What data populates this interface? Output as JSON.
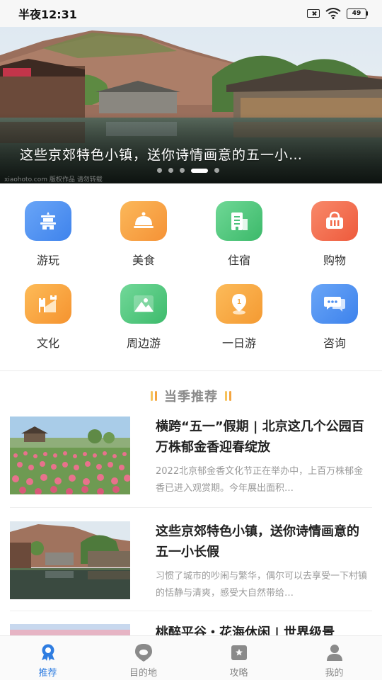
{
  "status_bar": {
    "time": "半夜12:31",
    "battery": "49"
  },
  "banner": {
    "caption": "这些京郊特色小镇，送你诗情画意的五一小…",
    "watermark": "xiaohoto.com 版权作品 请勿转载",
    "dot_count": 5,
    "active_dot_index": 3
  },
  "categories": [
    {
      "label": "游玩",
      "icon": "pagoda-icon",
      "color": "#4a8ef0"
    },
    {
      "label": "美食",
      "icon": "dish-cover-icon",
      "color": "#f7a040"
    },
    {
      "label": "住宿",
      "icon": "building-icon",
      "color": "#4cc27a"
    },
    {
      "label": "购物",
      "icon": "basket-icon",
      "color": "#f26a4a"
    },
    {
      "label": "文化",
      "icon": "great-wall-icon",
      "color": "#f8a23e"
    },
    {
      "label": "周边游",
      "icon": "mountain-icon",
      "color": "#4ec47e"
    },
    {
      "label": "一日游",
      "icon": "location-pin-icon",
      "color": "#f6a63c"
    },
    {
      "label": "咨询",
      "icon": "chat-bubble-icon",
      "color": "#4a8ef0"
    }
  ],
  "section": {
    "title": "当季推荐"
  },
  "articles": [
    {
      "title": "横跨“五一”假期 | 北京这几个公园百万株郁金香迎春绽放",
      "desc": "2022北京郁金香文化节正在举办中，上百万株郁金香已进入观赏期。今年展出面积…"
    },
    {
      "title": "这些京郊特色小镇，送你诗情画意的五一小长假",
      "desc": "习惯了城市的吵闹与繁华，偶尔可以去享受一下村镇的恬静与清爽，感受大自然带给…"
    },
    {
      "title": "桃醉平谷・花海休闲 | 世界级景",
      "desc": ""
    }
  ],
  "bottom_nav": [
    {
      "label": "推荐",
      "icon": "recommend-badge-icon",
      "active": true
    },
    {
      "label": "目的地",
      "icon": "map-pin-icon",
      "active": false
    },
    {
      "label": "攻略",
      "icon": "guide-book-icon",
      "active": false
    },
    {
      "label": "我的",
      "icon": "user-icon",
      "active": false
    }
  ],
  "colors": {
    "accent": "#2f7de1",
    "section_bar": "#f4a540"
  }
}
